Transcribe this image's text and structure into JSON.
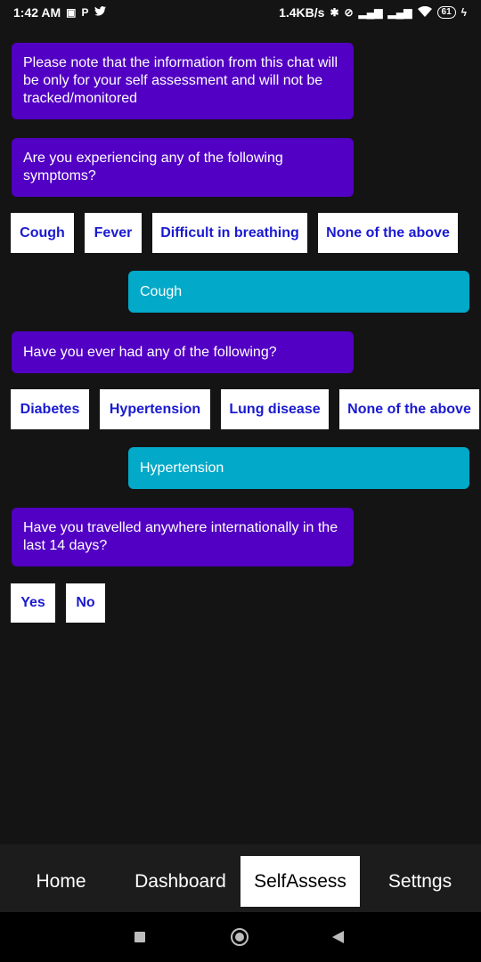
{
  "status_bar": {
    "time": "1:42 AM",
    "left_icons": [
      "gallery-icon",
      "p-icon",
      "twitter-icon"
    ],
    "speed": "1.4KB/s",
    "battery": "61"
  },
  "messages": {
    "bot1": "Please note that the information from this chat will be only for your self assessment and will not be tracked/monitored",
    "bot2": "Are you experiencing any of the following symptoms?",
    "user1": "Cough",
    "bot3": "Have you ever had any of the following?",
    "user2": "Hypertension",
    "bot4": "Have you travelled anywhere internationally in the last 14 days?"
  },
  "options": {
    "symptoms": [
      "Cough",
      "Fever",
      "Difficult in breathing",
      "None of the above"
    ],
    "conditions": [
      "Diabetes",
      "Hypertension",
      "Lung disease",
      "None of the above"
    ],
    "travel": [
      "Yes",
      "No"
    ]
  },
  "nav": {
    "tabs": [
      "Home",
      "Dashboard",
      "SelfAssess",
      "Settngs"
    ],
    "active": "SelfAssess"
  },
  "colors": {
    "bot_bubble": "#5200c3",
    "user_bubble": "#02a9c8",
    "chip_text": "#1a1ad0",
    "background": "#141414"
  }
}
